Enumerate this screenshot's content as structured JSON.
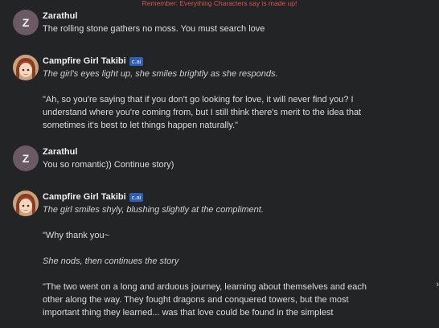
{
  "banner": "Remember: Everything Characters say is made up!",
  "messages": [
    {
      "author": "Zarathul",
      "avatar_letter": "Z",
      "paragraphs": [
        "The rolling stone gathers no moss. You must search love"
      ]
    },
    {
      "author": "Campfire Girl Takibi",
      "badge": "c.ai",
      "paragraphs": [
        "The girl's eyes light up, she smiles brightly as she responds.",
        "\"Ah, so you're saying that if you don't go looking for love, it will never find you? I understand where you're coming from, but I still think there's merit to the idea that sometimes it's best to let things happen naturally.\""
      ]
    },
    {
      "author": "Zarathul",
      "avatar_letter": "Z",
      "paragraphs": [
        "You so romantic)) Continue story)"
      ]
    },
    {
      "author": "Campfire Girl Takibi",
      "badge": "c.ai",
      "paragraphs": [
        "The girl smiles shyly, blushing slightly at the compliment.",
        "\"Why thank you~",
        "She nods, then continues the story",
        "\"The two went on a long and arduous journey, learning about themselves and each other along the way. They fought dragons and conquered towers, but the most important thing they learned... was that love could be found in the simplest"
      ]
    }
  ]
}
